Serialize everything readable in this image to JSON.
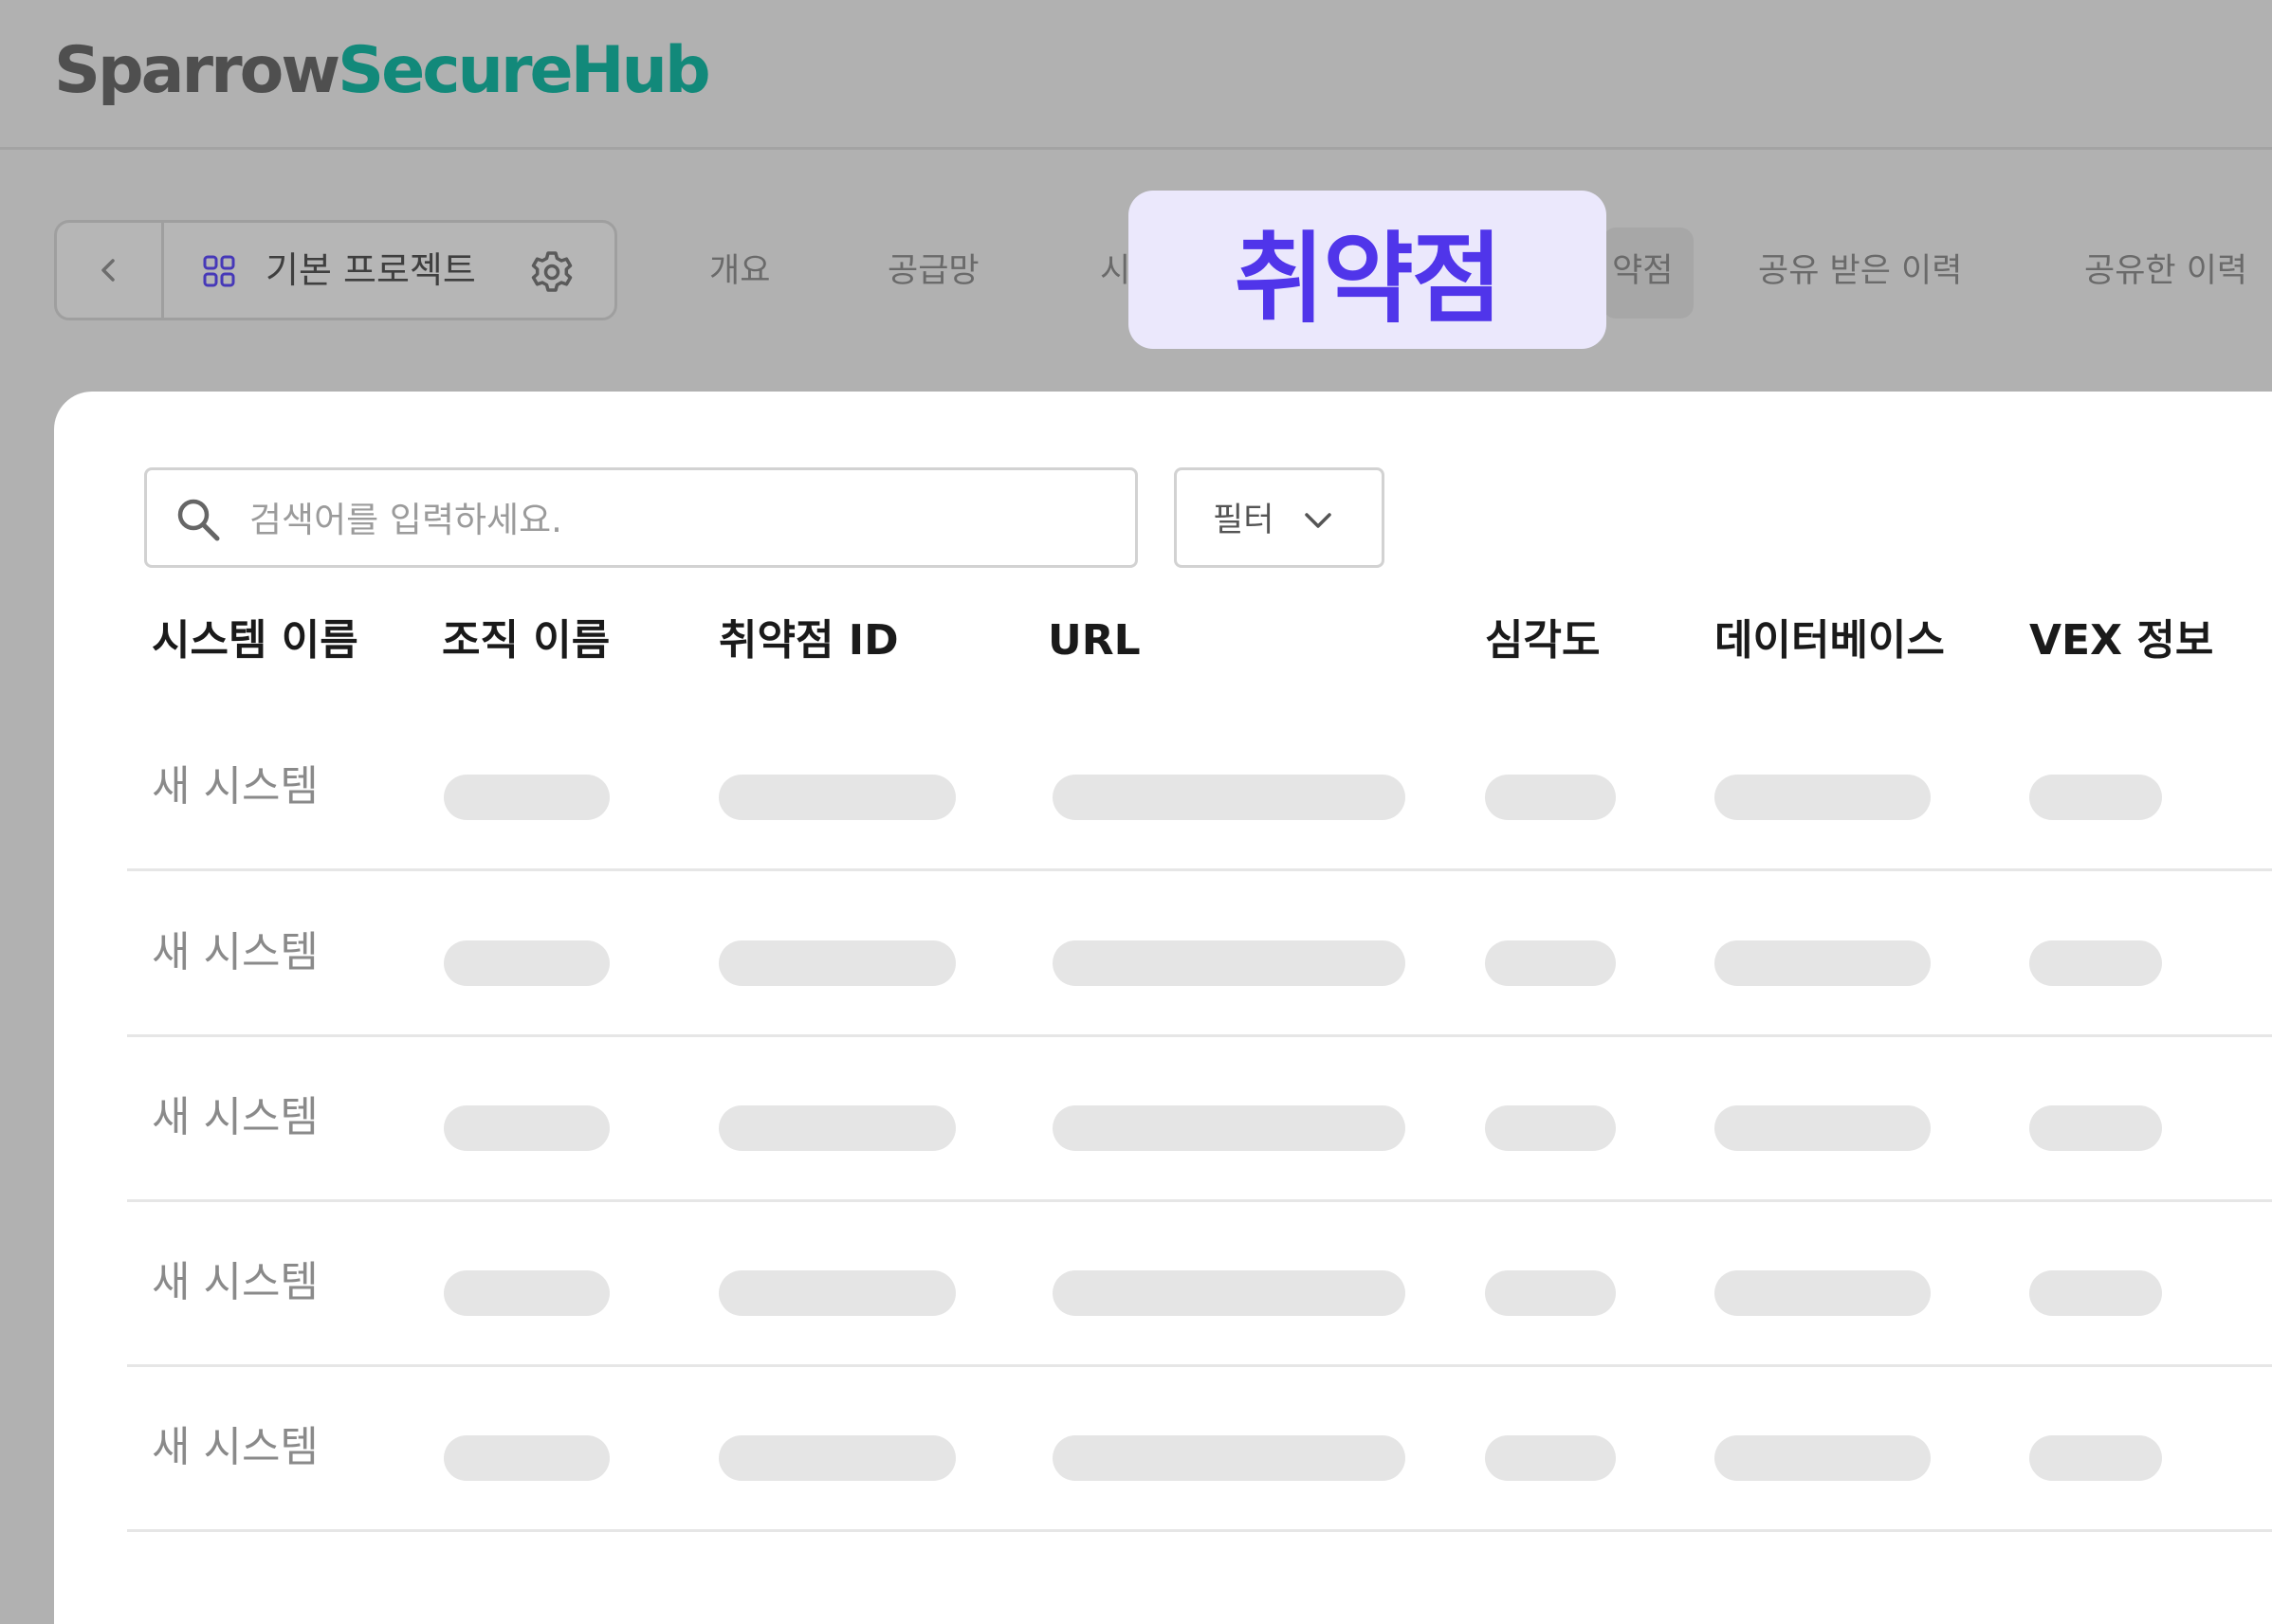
{
  "header": {
    "brand_part1": "Sparrow",
    "brand_part2": "SecureHub",
    "brand_colors": {
      "part1": "#4f4f4f",
      "part2": "#12897a"
    }
  },
  "project": {
    "back_icon": "chevron-left-icon",
    "grid_icon": "grid-icon",
    "name": "기본 프로젝트",
    "settings_icon": "gear-icon"
  },
  "tabs": [
    {
      "label": "개요"
    },
    {
      "label": "공급망"
    },
    {
      "label": "시"
    },
    {
      "label": "약점"
    },
    {
      "label": "공유 받은 이력"
    },
    {
      "label": "공유한 이력"
    }
  ],
  "tooltip": {
    "label": "취약점",
    "color": "#5035ea",
    "background": "#ebe8fc"
  },
  "search": {
    "placeholder": "검색어를 입력하세요.",
    "icon": "search-icon"
  },
  "filter": {
    "label": "필터",
    "icon": "chevron-down-icon"
  },
  "table": {
    "columns": [
      "시스템 이름",
      "조직 이름",
      "취약점 ID",
      "URL",
      "심각도",
      "데이터베이스",
      "VEX 정보"
    ],
    "rows": [
      {
        "system_name": "새 시스템"
      },
      {
        "system_name": "새 시스템"
      },
      {
        "system_name": "새 시스템"
      },
      {
        "system_name": "새 시스템"
      },
      {
        "system_name": "새 시스템"
      }
    ],
    "loading": true
  }
}
